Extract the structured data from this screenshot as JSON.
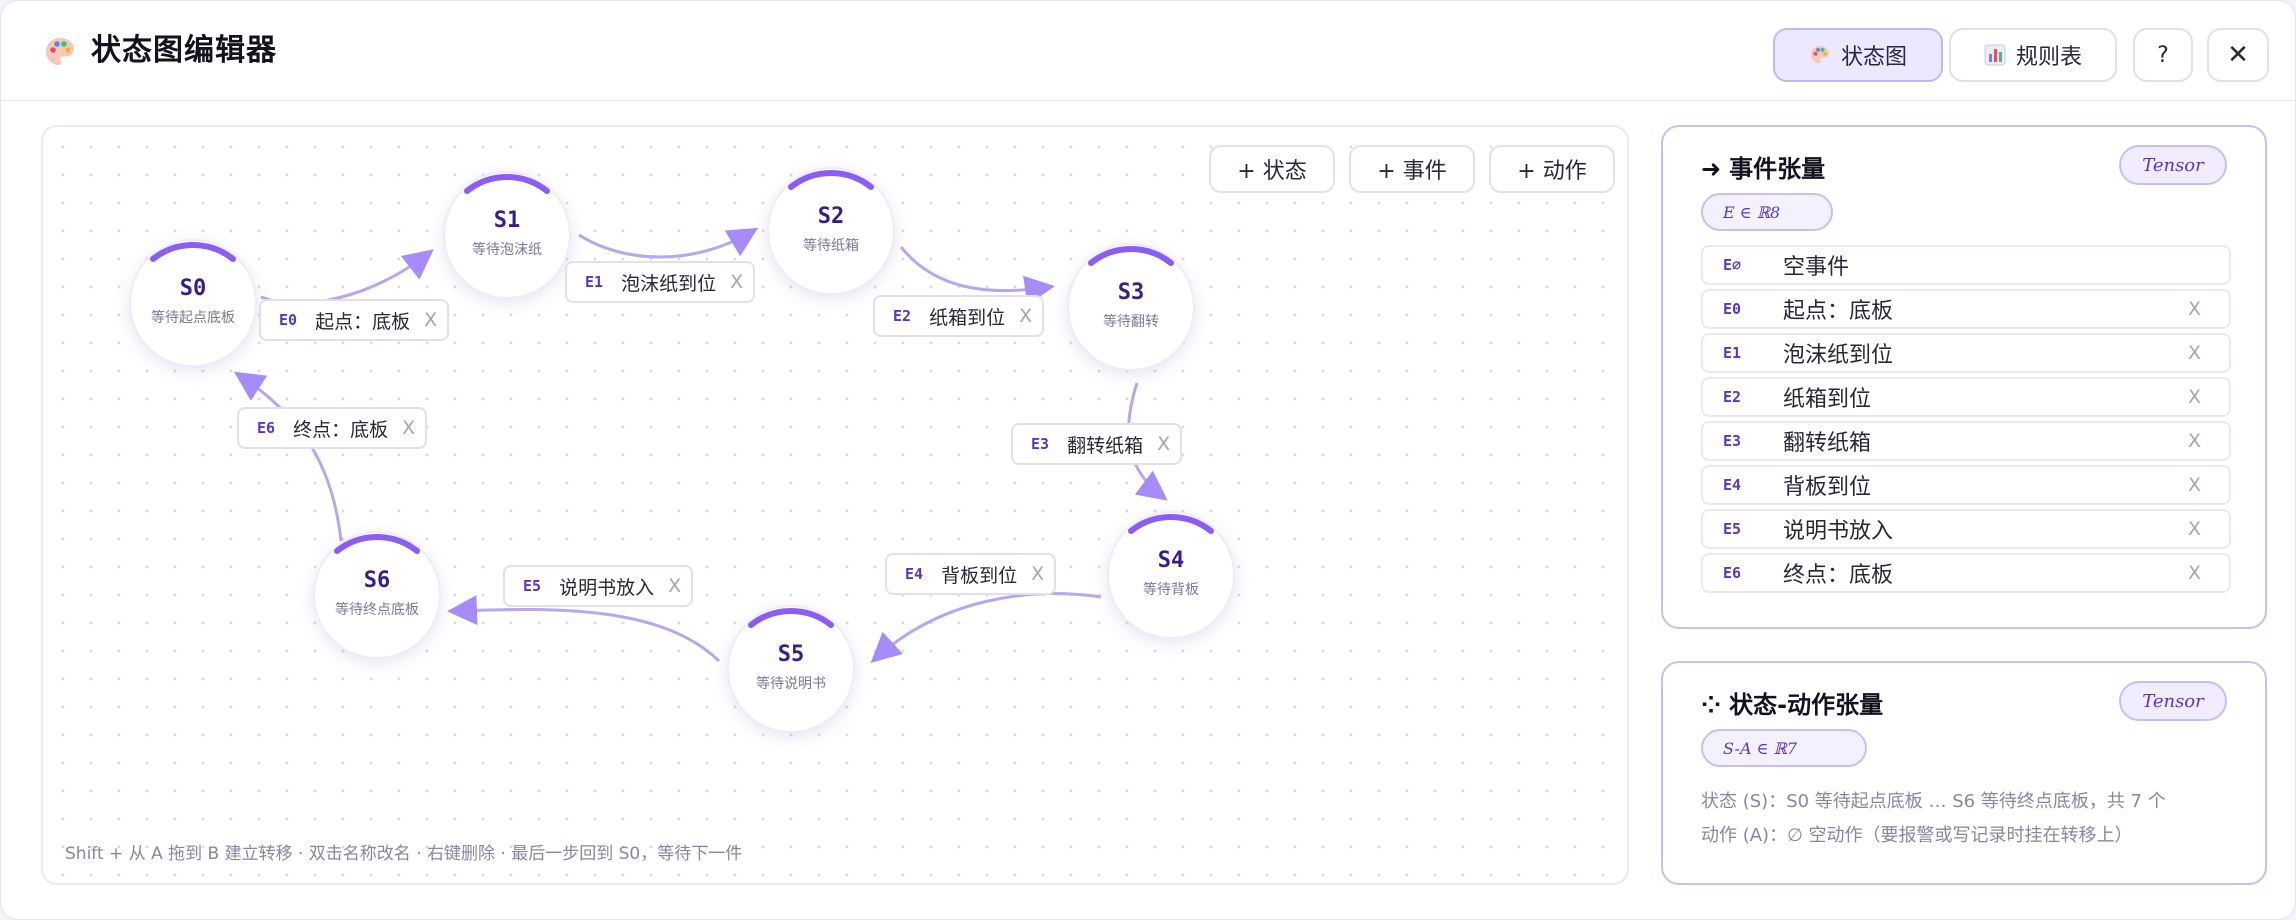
{
  "header": {
    "title": "状态图编辑器",
    "tab_state": "状态图",
    "tab_rules": "规则表",
    "help": "?",
    "close": "✕"
  },
  "toolbar": {
    "add_state": "+ 状态",
    "add_event": "+ 事件",
    "add_action": "+ 动作"
  },
  "states": [
    {
      "id": "S0",
      "name": "等待起点底板"
    },
    {
      "id": "S1",
      "name": "等待泡沫纸"
    },
    {
      "id": "S2",
      "name": "等待纸箱"
    },
    {
      "id": "S3",
      "name": "等待翻转"
    },
    {
      "id": "S4",
      "name": "等待背板"
    },
    {
      "id": "S5",
      "name": "等待说明书"
    },
    {
      "id": "S6",
      "name": "等待终点底板"
    }
  ],
  "transitions": [
    {
      "event": "E0",
      "label": "起点：底板",
      "from": "S0",
      "to": "S1",
      "delete": "X"
    },
    {
      "event": "E1",
      "label": "泡沫纸到位",
      "from": "S1",
      "to": "S2",
      "delete": "X"
    },
    {
      "event": "E2",
      "label": "纸箱到位",
      "from": "S2",
      "to": "S3",
      "delete": "X"
    },
    {
      "event": "E3",
      "label": "翻转纸箱",
      "from": "S3",
      "to": "S4",
      "delete": "X"
    },
    {
      "event": "E4",
      "label": "背板到位",
      "from": "S4",
      "to": "S5",
      "delete": "X"
    },
    {
      "event": "E5",
      "label": "说明书放入",
      "from": "S5",
      "to": "S6",
      "delete": "X"
    },
    {
      "event": "E6",
      "label": "终点：底板",
      "from": "S6",
      "to": "S0",
      "delete": "X"
    }
  ],
  "canvas_hint": "Shift + 从 A 拖到 B 建立转移 · 双击名称改名 · 右键删除 · 最后一步回到 S0，等待下一件",
  "event_panel": {
    "title": "事件张量",
    "title_icon": "➜",
    "tag": "Tensor",
    "dim": "E  ∈  ℝ8",
    "events": [
      {
        "id": "E∅",
        "name": "空事件",
        "delete": ""
      },
      {
        "id": "E0",
        "name": "起点：底板",
        "delete": "X"
      },
      {
        "id": "E1",
        "name": "泡沫纸到位",
        "delete": "X"
      },
      {
        "id": "E2",
        "name": "纸箱到位",
        "delete": "X"
      },
      {
        "id": "E3",
        "name": "翻转纸箱",
        "delete": "X"
      },
      {
        "id": "E4",
        "name": "背板到位",
        "delete": "X"
      },
      {
        "id": "E5",
        "name": "说明书放入",
        "delete": "X"
      },
      {
        "id": "E6",
        "name": "终点：底板",
        "delete": "X"
      }
    ]
  },
  "sa_panel": {
    "title": "状态-动作张量",
    "title_icon": "⁘",
    "tag": "Tensor",
    "dim": "S-A  ∈  ℝ7",
    "state_line": "状态 (S)：S0 等待起点底板 … S6 等待终点底板，共 7 个",
    "action_line": "动作 (A)：∅ 空动作（要报警或写记录时挂在转移上）"
  },
  "colors": {
    "accent": "#8b5cf6",
    "edge": "#b8a6f2",
    "arrow": "#a78bfa",
    "id_text": "#5b35c9"
  }
}
